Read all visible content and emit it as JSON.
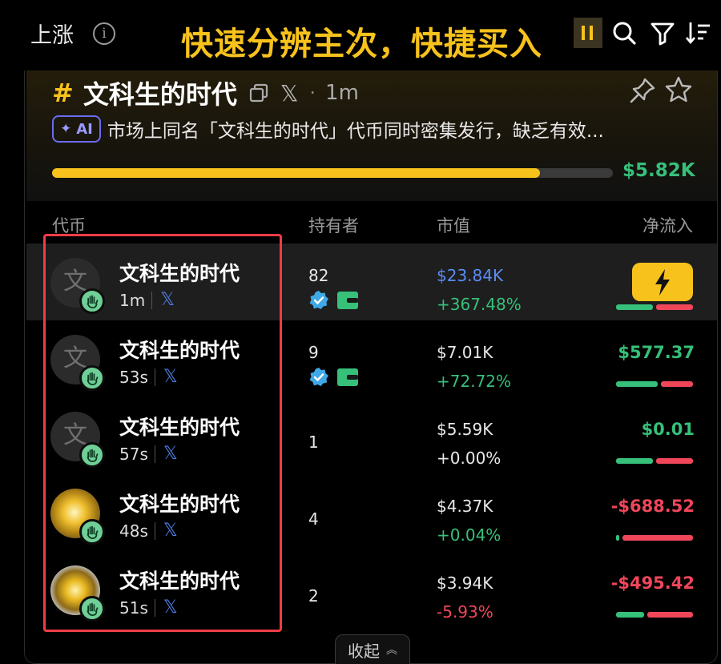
{
  "topbar": {
    "tab_label": "上涨",
    "banner": "快速分辨主次，快捷买入",
    "icons": [
      "info-icon",
      "pause-icon",
      "search-icon",
      "filter-icon",
      "sort-icon"
    ]
  },
  "token": {
    "hash": "#",
    "title": "文科生的时代",
    "age": "1m",
    "separator": "·",
    "ai_label": "AI",
    "ai_summary": "市场上同名「文科生的时代」代币同时密集发行，缺乏有效...",
    "progress": 0.87,
    "progress_value": "$5.82K"
  },
  "columns": {
    "token": "代币",
    "holders": "持有者",
    "market_cap": "市值",
    "net_inflow": "净流入"
  },
  "rows": [
    {
      "name": "文科生的时代",
      "age": "1m",
      "holders": "82",
      "verified": true,
      "mcap": "$23.84K",
      "change": "+367.48%",
      "change_color": "#36c07a",
      "inflow": "",
      "buy_ratio": 0.5,
      "avatar_char": "文"
    },
    {
      "name": "文科生的时代",
      "age": "53s",
      "holders": "9",
      "verified": true,
      "mcap": "$7.01K",
      "change": "+72.72%",
      "change_color": "#36c07a",
      "inflow": "$577.37",
      "inflow_color": "#36c07a",
      "buy_ratio": 0.56,
      "avatar_char": "文"
    },
    {
      "name": "文科生的时代",
      "age": "57s",
      "holders": "1",
      "verified": false,
      "mcap": "$5.59K",
      "change": "+0.00%",
      "change_color": "#e8e8e8",
      "inflow": "$0.01",
      "inflow_color": "#36c07a",
      "buy_ratio": 0.5,
      "avatar_char": "文"
    },
    {
      "name": "文科生的时代",
      "age": "48s",
      "holders": "4",
      "verified": false,
      "mcap": "$4.37K",
      "change": "+0.04%",
      "change_color": "#36c07a",
      "inflow": "-$688.52",
      "inflow_color": "#f0465a",
      "buy_ratio": 0.04,
      "avatar_char": ""
    },
    {
      "name": "文科生的时代",
      "age": "51s",
      "holders": "2",
      "verified": false,
      "mcap": "$3.94K",
      "change": "-5.93%",
      "change_color": "#f0465a",
      "inflow": "-$495.42",
      "inflow_color": "#f0465a",
      "buy_ratio": 0.38,
      "avatar_char": ""
    }
  ],
  "collapse_label": "收起"
}
